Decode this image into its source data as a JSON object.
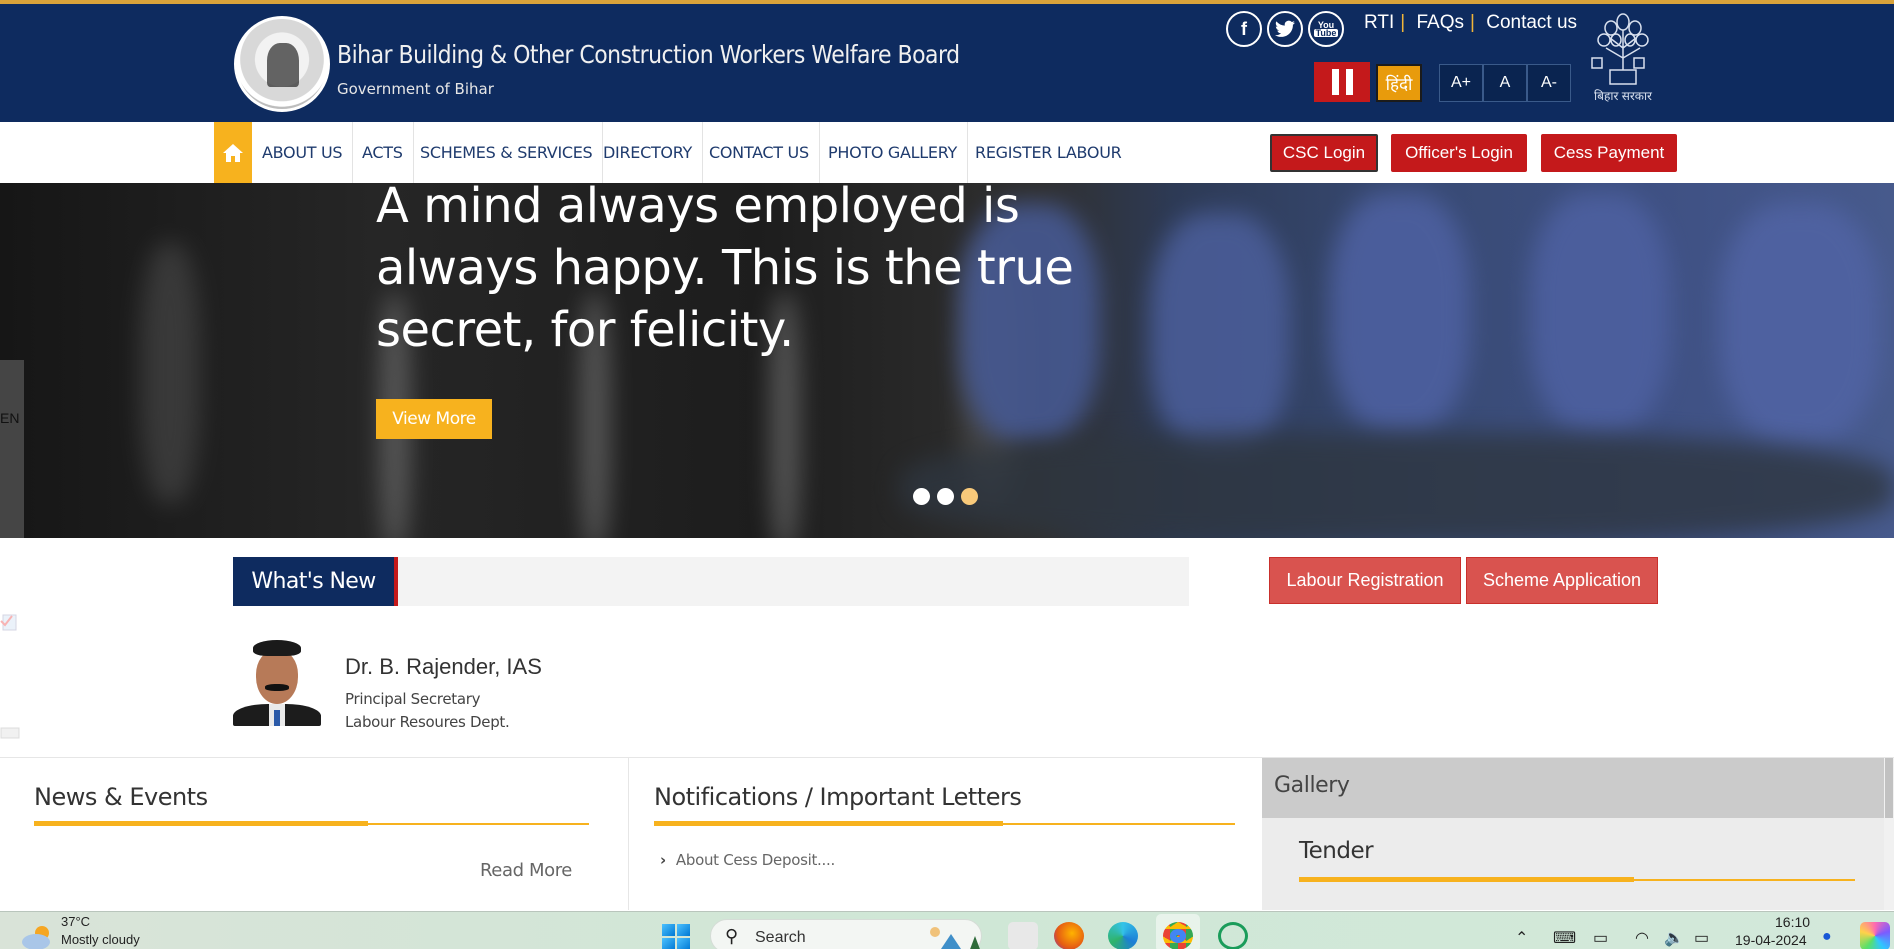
{
  "header": {
    "title": "Bihar Building & Other Construction Workers Welfare Board",
    "subtitle": "Government of Bihar",
    "social": [
      {
        "name": "facebook",
        "glyph": "f"
      },
      {
        "name": "twitter",
        "glyph": "🐦"
      },
      {
        "name": "youtube",
        "glyph": "You Tube"
      }
    ],
    "top_links": [
      "RTI",
      "FAQs",
      "Contact us"
    ],
    "separator": "|",
    "hindi_label": "हिंदी",
    "font_sizes": [
      "A+",
      "A",
      "A-"
    ],
    "emblem_caption": "बिहार सरकार"
  },
  "nav": {
    "items": [
      "ABOUT US",
      "ACTS",
      "SCHEMES & SERVICES",
      "DIRECTORY",
      "CONTACT US",
      "PHOTO GALLERY",
      "REGISTER LABOUR"
    ],
    "buttons": [
      "CSC Login",
      "Officer's Login",
      "Cess Payment"
    ]
  },
  "hero": {
    "quote": "A mind always employed is always happy. This is the true secret, for felicity.",
    "cta": "View More",
    "slides": 3,
    "active_slide": 3,
    "lang_tab": "EN"
  },
  "whats_new": {
    "label": "What's New"
  },
  "actions": [
    "Labour Registration",
    "Scheme Application"
  ],
  "officer": {
    "name": "Dr. B. Rajender, IAS",
    "designation": "Principal Secretary",
    "department": "Labour Resoures Dept."
  },
  "panels": {
    "news": {
      "title": "News & Events",
      "read_more": "Read More"
    },
    "notifications": {
      "title": "Notifications / Important Letters",
      "items": [
        "About Cess Deposit...."
      ]
    },
    "gallery": {
      "title": "Gallery"
    },
    "tender": {
      "title": "Tender"
    }
  },
  "taskbar": {
    "temperature": "37°C",
    "weather": "Mostly cloudy",
    "search_placeholder": "Search",
    "time": "16:10",
    "date": "19-04-2024"
  },
  "colors": {
    "header_bg": "#0e2b5f",
    "accent_yellow": "#f7b21e",
    "accent_red": "#c4191b",
    "action_red": "#d9534f"
  }
}
